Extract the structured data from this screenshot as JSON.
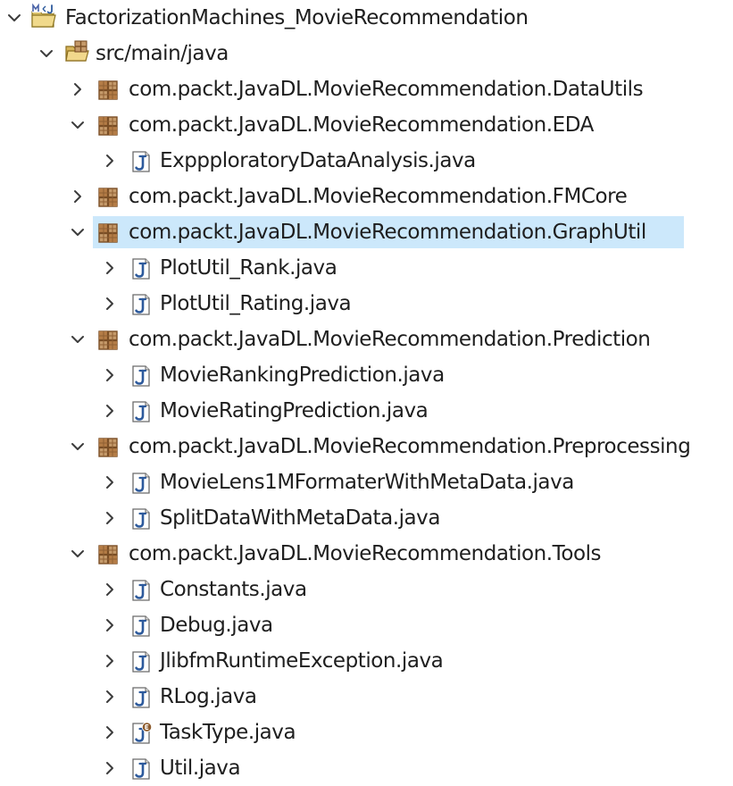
{
  "tree": {
    "project": {
      "label": "FactorizationMachines_MovieRecommendation",
      "icon": "java-project-icon",
      "expanded": true
    },
    "source_folder": {
      "label": "src/main/java",
      "icon": "source-folder-icon",
      "expanded": true
    },
    "packages": [
      {
        "label": "com.packt.JavaDL.MovieRecommendation.DataUtils",
        "expanded": false,
        "files": []
      },
      {
        "label": "com.packt.JavaDL.MovieRecommendation.EDA",
        "expanded": true,
        "files": [
          {
            "label": "ExppploratoryDataAnalysis.java"
          }
        ]
      },
      {
        "label": "com.packt.JavaDL.MovieRecommendation.FMCore",
        "expanded": false,
        "files": []
      },
      {
        "label": "com.packt.JavaDL.MovieRecommendation.GraphUtil",
        "expanded": true,
        "selected": true,
        "files": [
          {
            "label": "PlotUtil_Rank.java"
          },
          {
            "label": "PlotUtil_Rating.java"
          }
        ]
      },
      {
        "label": "com.packt.JavaDL.MovieRecommendation.Prediction",
        "expanded": true,
        "files": [
          {
            "label": "MovieRankingPrediction.java"
          },
          {
            "label": "MovieRatingPrediction.java"
          }
        ]
      },
      {
        "label": "com.packt.JavaDL.MovieRecommendation.Preprocessing",
        "expanded": true,
        "files": [
          {
            "label": "MovieLens1MFormaterWithMetaData.java"
          },
          {
            "label": "SplitDataWithMetaData.java"
          }
        ]
      },
      {
        "label": "com.packt.JavaDL.MovieRecommendation.Tools",
        "expanded": true,
        "files": [
          {
            "label": "Constants.java"
          },
          {
            "label": "Debug.java"
          },
          {
            "label": "JlibfmRuntimeException.java"
          },
          {
            "label": "RLog.java"
          },
          {
            "label": "TaskType.java",
            "enum": true
          },
          {
            "label": "Util.java"
          }
        ]
      }
    ]
  },
  "colors": {
    "selection": "#cce8fb",
    "text": "#1e1e1e",
    "chevron": "#3c3c3c",
    "package_brown": "#9b6a3c",
    "java_file_blue": "#2d5a9c",
    "enum_badge": "#8c5a2b"
  }
}
